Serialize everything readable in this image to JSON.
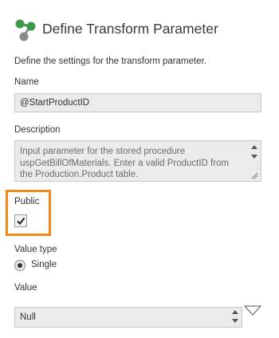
{
  "header": {
    "title": "Define Transform Parameter",
    "icon": "transform-parameter-icon"
  },
  "intro_text": "Define the settings for the transform parameter.",
  "name_field": {
    "label": "Name",
    "value": "@StartProductID"
  },
  "description_field": {
    "label": "Description",
    "value": "Input parameter for the stored procedure uspGetBillOfMaterials. Enter a valid ProductID from the Production.Product table."
  },
  "public_field": {
    "label": "Public",
    "checked": true
  },
  "value_type": {
    "label": "Value type",
    "selected_option": "Single"
  },
  "value_field": {
    "label": "Value",
    "value": "Null"
  },
  "colors": {
    "highlight": "#f08a1c",
    "logo_green": "#3a9a4a",
    "logo_grey": "#8a8a8a"
  }
}
